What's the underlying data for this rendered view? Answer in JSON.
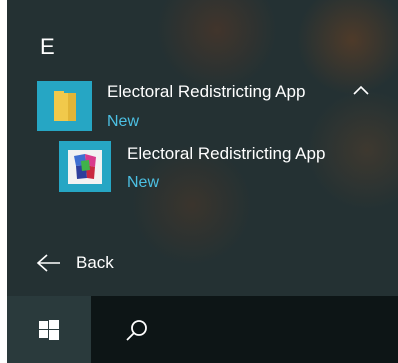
{
  "start_menu": {
    "section_letter": "E",
    "folder": {
      "title": "Electoral Redistricting App",
      "badge": "New",
      "expanded_icon": "chevron-up-icon"
    },
    "app": {
      "title": "Electoral Redistricting App",
      "badge": "New"
    },
    "back_label": "Back"
  },
  "taskbar": {
    "start_icon": "windows-logo-icon",
    "search_icon": "search-icon"
  },
  "colors": {
    "accent": "#26a6c4",
    "badge_text": "#4cc0e3",
    "menu_background": "#243133",
    "taskbar_background": "#0d1516"
  }
}
